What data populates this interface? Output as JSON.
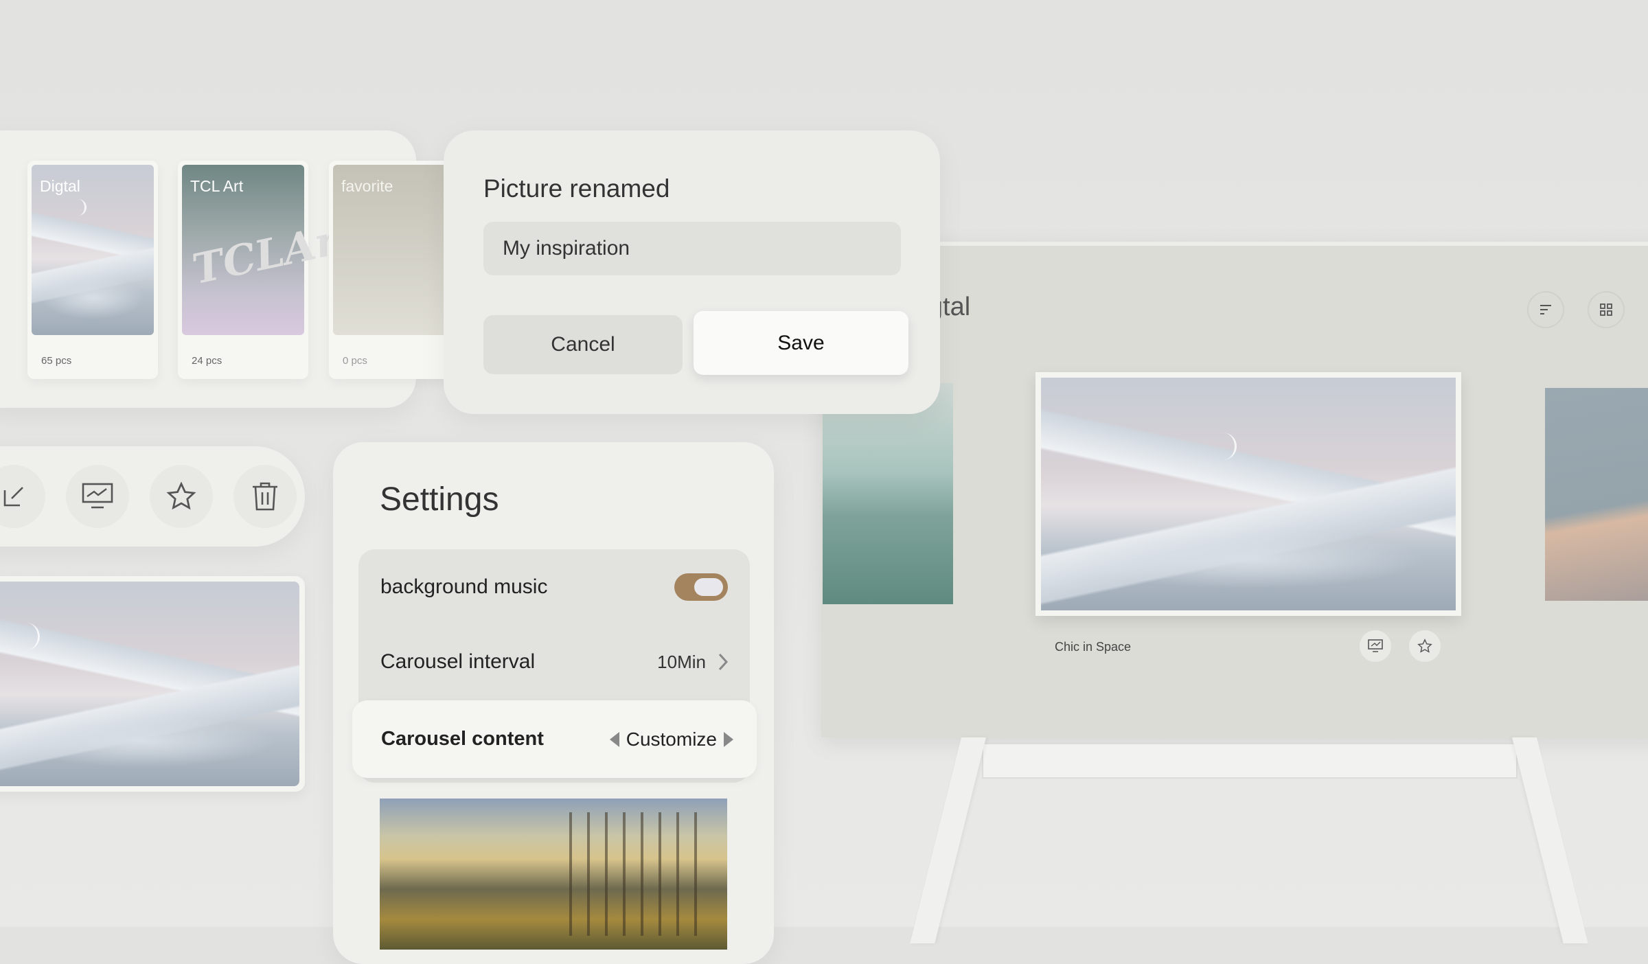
{
  "albums": [
    {
      "title": "Digtal",
      "count": "65 pcs"
    },
    {
      "title": "TCL Art",
      "count": "24 pcs",
      "logo": "TCLArt"
    },
    {
      "title": "favorite",
      "count": "0 pcs"
    }
  ],
  "rename_dialog": {
    "title": "Picture renamed",
    "input_value": "My inspiration",
    "cancel_label": "Cancel",
    "save_label": "Save"
  },
  "toolbar": {
    "icons": [
      "edit-icon",
      "display-icon",
      "star-icon",
      "trash-icon"
    ]
  },
  "settings": {
    "title": "Settings",
    "background_music_label": "background music",
    "background_music_on": true,
    "interval_label": "Carousel interval",
    "interval_value": "10Min",
    "content_label": "Carousel content",
    "content_value": "Customize"
  },
  "gallery": {
    "title": "Digtal",
    "caption": "Chic in Space"
  },
  "colors": {
    "accent": "#a4845f",
    "bg": "#e3e3e1",
    "panel": "#efefec"
  }
}
